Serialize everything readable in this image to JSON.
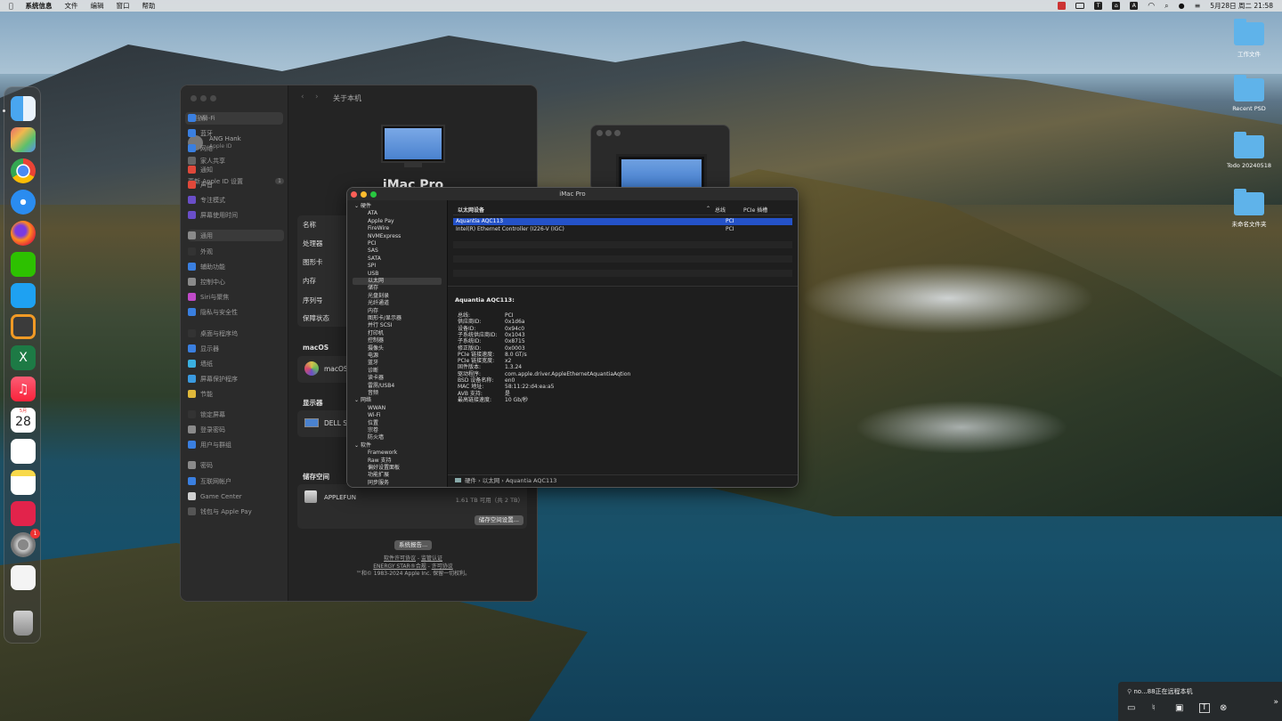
{
  "menubar": {
    "app": "系统信息",
    "items": [
      "文件",
      "编辑",
      "窗口",
      "帮助"
    ],
    "clock": "5月28日 周二 21:58",
    "status_icons": [
      "app-icon",
      "display-icon",
      "text-icon",
      "lock-icon",
      "keyboard-a-icon",
      "wifi-icon",
      "search-icon",
      "user-icon",
      "control-center-icon"
    ]
  },
  "desktop": {
    "icons": [
      "工作文件",
      "Recent PSD",
      "Todo 20240518",
      "未命名文件夹"
    ]
  },
  "dock": {
    "apps": [
      "finder",
      "launchpad",
      "chrome",
      "safari",
      "firefox",
      "wechat",
      "mail",
      "sublime",
      "excel",
      "music",
      "calendar",
      "reminders",
      "notes",
      "parallels",
      "system-settings",
      "preview",
      "trash"
    ],
    "calendar_month": "5月",
    "calendar_day": "28",
    "settings_badge": "1"
  },
  "settings": {
    "title": "关于本机",
    "search_placeholder": "搜索",
    "user_name": "ANG Hank",
    "user_sub": "Apple ID",
    "family": "家人共享",
    "update_label": "更新 Apple ID 设置",
    "update_badge": "1",
    "sidebar": [
      "Wi-Fi",
      "蓝牙",
      "网络",
      "通知",
      "声音",
      "专注模式",
      "屏幕使用时间",
      "通用",
      "外观",
      "辅助功能",
      "控制中心",
      "Siri与聚焦",
      "隐私与安全性",
      "桌面与程序坞",
      "显示器",
      "墙纸",
      "屏幕保护程序",
      "节能",
      "锁定屏幕",
      "登录密码",
      "用户与群组",
      "密码",
      "互联网帐户",
      "Game Center",
      "钱包与 Apple Pay"
    ],
    "selected_index": 7,
    "device_name": "iMac Pro",
    "rows": [
      "名称",
      "处理器",
      "图形卡",
      "内存",
      "序列号",
      "保障状态"
    ],
    "macos_section": "macOS",
    "macos_value": "macOS",
    "display_section": "显示器",
    "display_value": "DELL S",
    "storage_section": "储存空间",
    "storage_name": "APPLEFUN",
    "storage_value": "1.61 TB 可用（共 2 TB）",
    "storage_button": "储存空间设置...",
    "report_button": "系统报告...",
    "links1": [
      "软件许可协议",
      "监管认证"
    ],
    "links2": [
      "ENERGY STAR®合规",
      "许可协议"
    ],
    "copyright": "™和© 1983-2024 Apple Inc. 保留一切权利。"
  },
  "sysinfo": {
    "title": "iMac Pro",
    "tree": [
      {
        "cat": "硬件",
        "items": [
          "ATA",
          "Apple Pay",
          "FireWire",
          "NVMExpress",
          "PCI",
          "SAS",
          "SATA",
          "SPI",
          "USB",
          "以太网",
          "储存",
          "光盘刻录",
          "光纤通道",
          "内存",
          "图形卡/显示器",
          "并行 SCSI",
          "打印机",
          "控制器",
          "摄像头",
          "电源",
          "蓝牙",
          "诊断",
          "读卡器",
          "雷雳/USB4",
          "音频"
        ]
      },
      {
        "cat": "网络",
        "items": [
          "WWAN",
          "Wi-Fi",
          "位置",
          "宗卷",
          "防火墙"
        ]
      },
      {
        "cat": "软件",
        "items": [
          "Framework",
          "Raw 支持",
          "偏好设置面板",
          "功能扩展",
          "同步服务"
        ]
      }
    ],
    "selected_item": "以太网",
    "columns": [
      "以太网设备",
      "总线",
      "PCIe 插槽"
    ],
    "devices": [
      {
        "name": "Aquantia AQC113",
        "bus": "PCI"
      },
      {
        "name": "Intel(R) Ethernet Controller (I226-V (IGC)",
        "bus": "PCI"
      }
    ],
    "detail_title": "Aquantia AQC113:",
    "details": [
      [
        "总线:",
        "PCI"
      ],
      [
        "供应商ID:",
        "0x1d6a"
      ],
      [
        "设备ID:",
        "0x94c0"
      ],
      [
        "子系统供应商ID:",
        "0x1043"
      ],
      [
        "子系统ID:",
        "0x8715"
      ],
      [
        "修正版ID:",
        "0x0003"
      ],
      [
        "PCIe 链接速度:",
        "8.0 GT/s"
      ],
      [
        "PCIe 链接宽度:",
        "x2"
      ],
      [
        "固件版本:",
        "1.3.24"
      ],
      [
        "驱动程序:",
        "com.apple.driver.AppleEthernetAquantiaAqtion"
      ],
      [
        "BSD 设备名称:",
        "en0"
      ],
      [
        "MAC 地址:",
        "58:11:22:d4:ea:a5"
      ],
      [
        "AVB 支持:",
        "是"
      ],
      [
        "最高链接速度:",
        "10 Gb/秒"
      ]
    ],
    "breadcrumb": [
      "硬件",
      "以太网",
      "Aquantia AQC113"
    ]
  },
  "remote": {
    "text": "no...88正在远程本机"
  }
}
